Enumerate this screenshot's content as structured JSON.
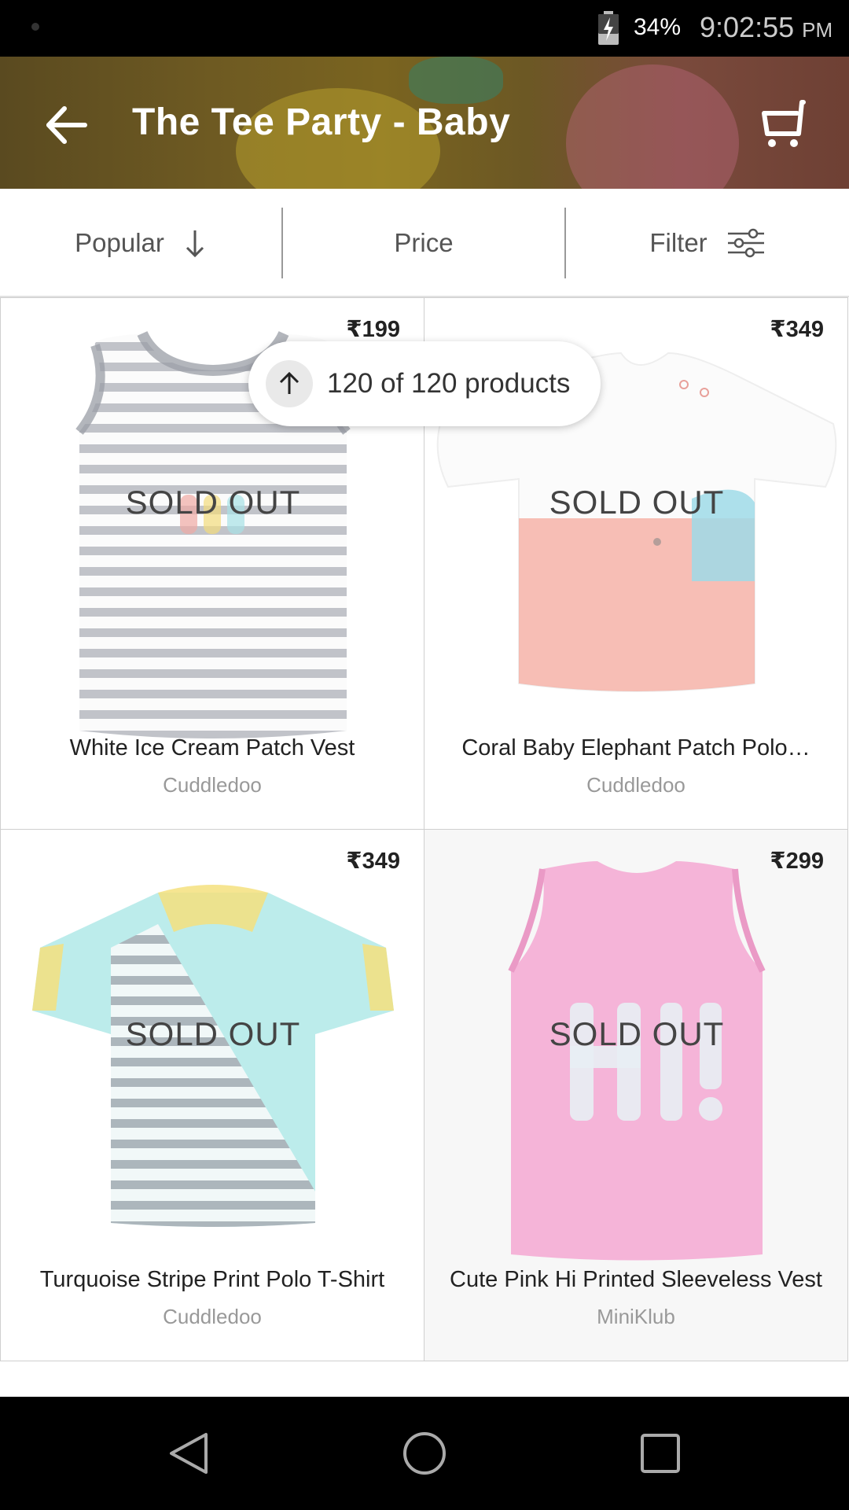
{
  "status_bar": {
    "battery_percent": "34%",
    "time": "9:02:55",
    "ampm": "PM"
  },
  "header": {
    "title": "The Tee Party - Baby",
    "back_icon": "arrow-left-icon",
    "cart_icon": "cart-icon"
  },
  "sort_bar": {
    "popular_label": "Popular",
    "price_label": "Price",
    "filter_label": "Filter"
  },
  "count_pill": {
    "text": "120 of 120 products"
  },
  "products": [
    {
      "price": "₹199",
      "title": "White Ice Cream Patch Vest",
      "brand": "Cuddledoo",
      "status": "SOLD OUT"
    },
    {
      "price": "₹349",
      "title": "Coral Baby Elephant Patch Polo…",
      "brand": "Cuddledoo",
      "status": "SOLD OUT"
    },
    {
      "price": "₹349",
      "title": "Turquoise Stripe Print Polo T-Shirt",
      "brand": "Cuddledoo",
      "status": "SOLD OUT"
    },
    {
      "price": "₹299",
      "title": "Cute Pink Hi Printed Sleeveless Vest",
      "brand": "MiniKlub",
      "status": "SOLD OUT"
    }
  ],
  "nav_bar": {
    "back": "nav-back-icon",
    "home": "nav-home-icon",
    "recents": "nav-recents-icon"
  }
}
